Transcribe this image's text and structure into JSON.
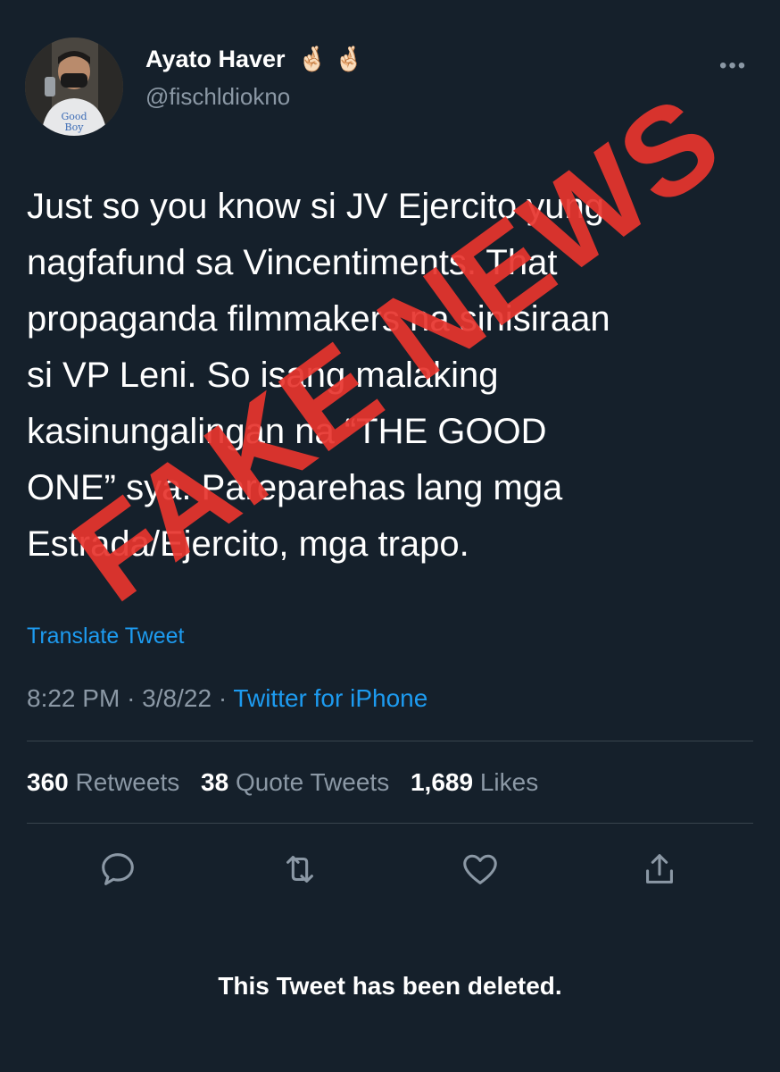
{
  "author": {
    "name": "Ayato Haver",
    "emoji": "🤞🏻 🤞🏻",
    "handle": "@fischldiokno"
  },
  "tweet": {
    "lines": [
      "Just so you know si JV Ejercito yung",
      "nagfafund sa Vincentiments. That",
      "propaganda filmmakers na sinisiraan",
      "si VP Leni. So isang malaking",
      "kasinungalingan na “THE GOOD",
      "ONE” sya. Pareparehas lang mga",
      "Estrada/Ejercito, mga trapo."
    ],
    "translate_label": "Translate Tweet",
    "time": "8:22 PM",
    "date": "3/8/22",
    "separator": "·",
    "source": "Twitter for iPhone"
  },
  "stats": {
    "retweets_count": "360",
    "retweets_label": "Retweets",
    "quotes_count": "38",
    "quotes_label": "Quote Tweets",
    "likes_count": "1,689",
    "likes_label": "Likes"
  },
  "actions": [
    "reply-icon",
    "retweet-icon",
    "like-icon",
    "share-icon"
  ],
  "stamp_text": "FAKE NEWS",
  "deleted_notice": "This Tweet has been deleted.",
  "colors": {
    "background": "#15202b",
    "muted": "#8b98a5",
    "link": "#1d9bf0",
    "stamp": "#e8352e"
  }
}
